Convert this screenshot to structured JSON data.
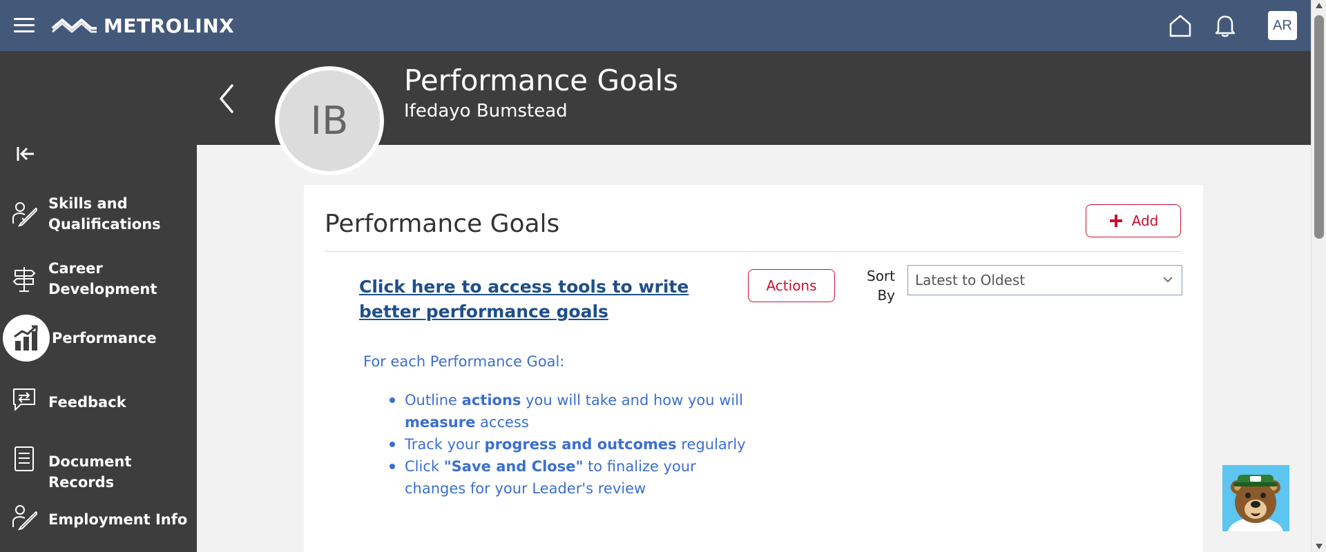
{
  "topbar": {
    "logo_text": "METROLINX",
    "user_initials": "AR"
  },
  "sidebar": {
    "items": [
      {
        "label_line1": "Skills and",
        "label_line2": "Qualifications"
      },
      {
        "label_line1": "Career",
        "label_line2": "Development"
      },
      {
        "label_line1": "Performance",
        "label_line2": ""
      },
      {
        "label_line1": "Feedback",
        "label_line2": ""
      },
      {
        "label_line1": "Document Records",
        "label_line2": ""
      },
      {
        "label_line1": "Employment Info",
        "label_line2": ""
      }
    ],
    "active_index": 2
  },
  "header": {
    "title": "Performance Goals",
    "employee_name": "Ifedayo Bumstead",
    "employee_initials": "IB"
  },
  "card": {
    "title": "Performance Goals",
    "add_label": "Add",
    "tools_link": "Click here to access tools to write better performance goals",
    "actions_label": "Actions",
    "sort_label": "Sort By",
    "sort_value": "Latest to Oldest",
    "intro": "For each Performance Goal:",
    "bullets": {
      "b1_pre": "Outline ",
      "b1_bold1": "actions",
      "b1_mid": " you will take and how you will ",
      "b1_bold2": "measure",
      "b1_post": " access",
      "b2_pre": "Track your ",
      "b2_bold": "progress and outcomes",
      "b2_post": " regularly",
      "b3_pre": "Click ",
      "b3_bold": "\"Save and Close\"",
      "b3_post": " to finalize your changes for your Leader's review"
    }
  },
  "colors": {
    "topbar": "#44597a",
    "sidebar": "#3d3d3d",
    "accent_red": "#c8102e",
    "link_blue": "#1e4f8a",
    "text_blue": "#3b6fcf"
  }
}
